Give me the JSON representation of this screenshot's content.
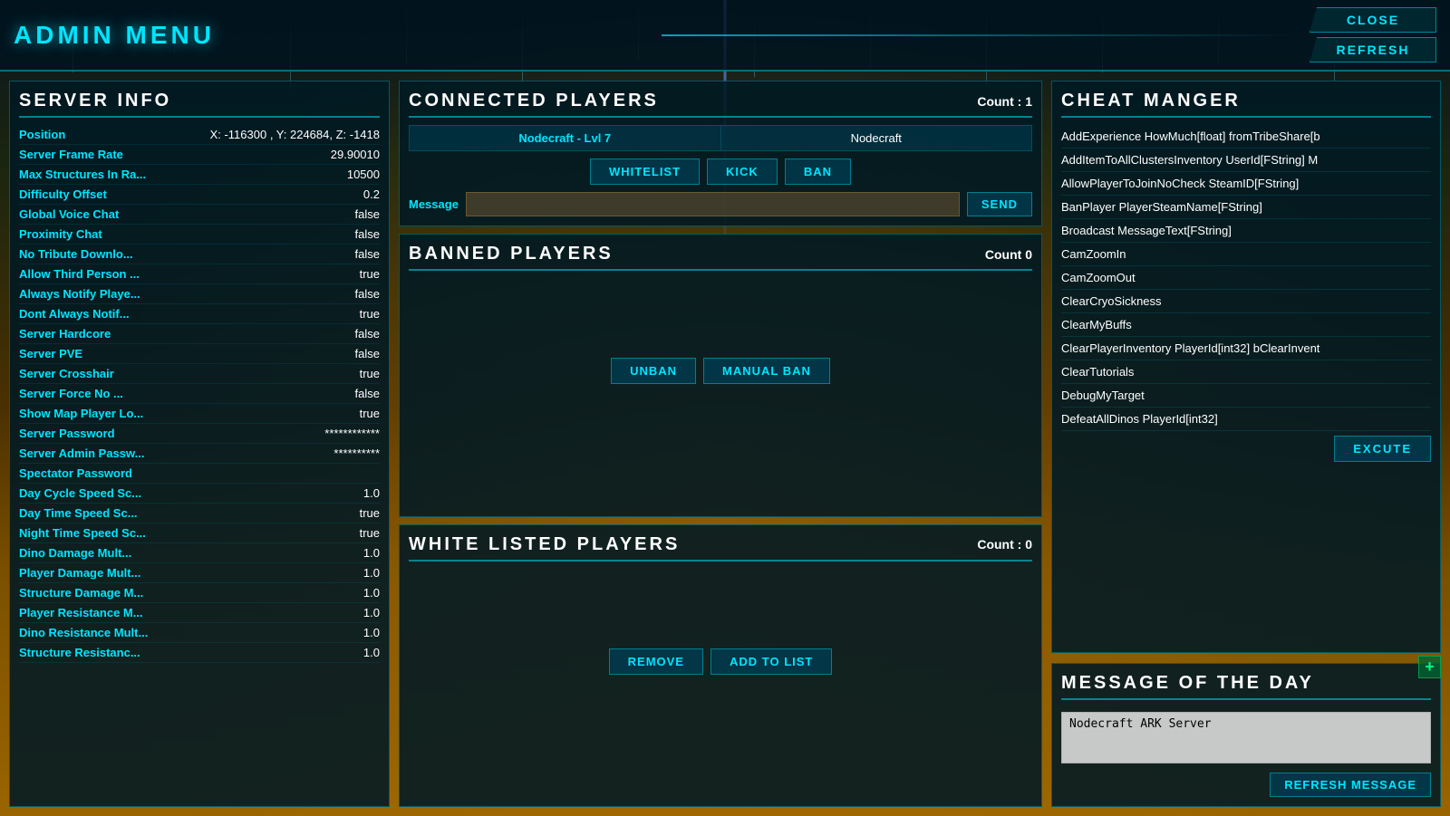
{
  "title": "ADMIN  MENU",
  "buttons": {
    "close": "CLOSE",
    "refresh": "REFRESH"
  },
  "server_info": {
    "title": "SERVER  INFO",
    "rows": [
      {
        "label": "Position",
        "value": "X: -116300 , Y: 224684, Z: -1418"
      },
      {
        "label": "Server Frame Rate",
        "value": "29.90010"
      },
      {
        "label": "Max Structures In Ra...",
        "value": "10500"
      },
      {
        "label": "Difficulty Offset",
        "value": "0.2"
      },
      {
        "label": "Global Voice Chat",
        "value": "false"
      },
      {
        "label": "Proximity Chat",
        "value": "false"
      },
      {
        "label": "No Tribute Downlo...",
        "value": "false"
      },
      {
        "label": "Allow Third Person ...",
        "value": "true"
      },
      {
        "label": "Always Notify Playe...",
        "value": "false"
      },
      {
        "label": "Dont Always Notif...",
        "value": "true"
      },
      {
        "label": "Server Hardcore",
        "value": "false"
      },
      {
        "label": "Server PVE",
        "value": "false"
      },
      {
        "label": "Server Crosshair",
        "value": "true"
      },
      {
        "label": "Server Force No ...",
        "value": "false"
      },
      {
        "label": "Show Map Player Lo...",
        "value": "true"
      },
      {
        "label": "Server Password",
        "value": "************"
      },
      {
        "label": "Server Admin Passw...",
        "value": "**********"
      },
      {
        "label": "Spectator Password",
        "value": ""
      },
      {
        "label": "Day Cycle Speed Sc...",
        "value": "1.0"
      },
      {
        "label": "Day Time Speed Sc...",
        "value": "true"
      },
      {
        "label": "Night Time Speed Sc...",
        "value": "true"
      },
      {
        "label": "Dino Damage Mult...",
        "value": "1.0"
      },
      {
        "label": "Player Damage Mult...",
        "value": "1.0"
      },
      {
        "label": "Structure Damage M...",
        "value": "1.0"
      },
      {
        "label": "Player Resistance M...",
        "value": "1.0"
      },
      {
        "label": "Dino Resistance Mult...",
        "value": "1.0"
      },
      {
        "label": "Structure Resistanc...",
        "value": "1.0"
      }
    ]
  },
  "connected_players": {
    "title": "CONNECTED  PLAYERS",
    "count_label": "Count : 1",
    "players": [
      {
        "name": "Nodecraft - Lvl 7",
        "tribe": "Nodecraft"
      }
    ],
    "buttons": {
      "whitelist": "WHITELIST",
      "kick": "KICK",
      "ban": "BAN",
      "send": "SEND"
    },
    "message_label": "Message",
    "message_placeholder": ""
  },
  "banned_players": {
    "title": "BANNED  PLAYERS",
    "count_label": "Count  0",
    "buttons": {
      "unban": "UNBAN",
      "manual_ban": "Manual Ban"
    },
    "players": []
  },
  "whitelisted_players": {
    "title": "WHITE  LISTED  PLAYERS",
    "count_label": "Count : 0",
    "buttons": {
      "remove": "REMOVE",
      "add_to_list": "ADD TO LIST"
    },
    "players": []
  },
  "cheat_manager": {
    "title": "CHEAT  MANGER",
    "commands": [
      "AddExperience HowMuch[float] fromTribeShare[b",
      "AddItemToAllClustersInventory UserId[FString] M",
      "AllowPlayerToJoinNoCheck SteamID[FString]",
      "BanPlayer PlayerSteamName[FString]",
      "Broadcast MessageText[FString]",
      "CamZoomIn",
      "CamZoomOut",
      "ClearCryoSickness",
      "ClearMyBuffs",
      "ClearPlayerInventory PlayerId[int32] bClearInvent",
      "ClearTutorials",
      "DebugMyTarget",
      "DefeatAllDinos PlayerId[int32]"
    ],
    "execute_btn": "EXCUTE"
  },
  "motd": {
    "title": "MESSAGE   OF  THE  DAY",
    "value": "Nodecraft ARK Server",
    "refresh_btn": "REFRESH MESSAGE"
  },
  "plus_icon": "+",
  "expand_icon": "◀"
}
